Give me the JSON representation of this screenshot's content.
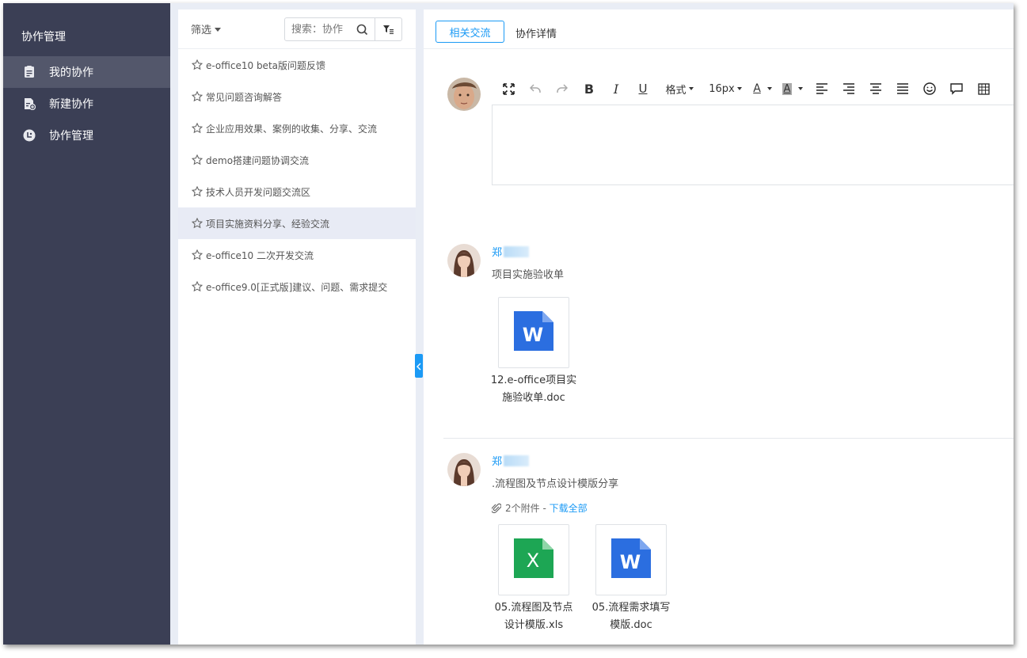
{
  "nav": {
    "title": "协作管理",
    "items": [
      {
        "label": "我的协作",
        "icon": "clipboard-icon",
        "active": true
      },
      {
        "label": "新建协作",
        "icon": "new-document-icon",
        "active": false
      },
      {
        "label": "协作管理",
        "icon": "manage-circle-icon",
        "active": false
      }
    ]
  },
  "list": {
    "filter_label": "筛选",
    "search_placeholder": "搜索：协作",
    "items": [
      "e-office10 beta版问题反馈",
      "常见问题咨询解答",
      "企业应用效果、案例的收集、分享、交流",
      "demo搭建问题协调交流",
      "技术人员开发问题交流区",
      "项目实施资料分享、经验交流",
      "e-office10 二次开发交流",
      "e-office9.0[正式版]建议、问题、需求提交"
    ],
    "selected_index": 5
  },
  "tabs": {
    "active": "相关交流",
    "other": "协作详情"
  },
  "toolbar": {
    "format_label": "格式",
    "size_label": "16px",
    "font_color_label": "A",
    "bg_color_label": "A",
    "bold": "B",
    "italic": "I",
    "underline": "U"
  },
  "posts": [
    {
      "author": "郑",
      "message": "项目实施验收单",
      "files": [
        {
          "name_line1": "12.e-office项目实",
          "name_line2": "施验收单.doc",
          "type": "word",
          "letter": "W"
        }
      ]
    },
    {
      "author": "郑",
      "message": ".流程图及节点设计模版分享",
      "attachments_count": "2个附件 -",
      "download_all": "下载全部",
      "files": [
        {
          "name_line1": "05.流程图及节点",
          "name_line2": "设计模版.xls",
          "type": "excel",
          "letter": "X"
        },
        {
          "name_line1": "05.流程需求填写",
          "name_line2": "模版.doc",
          "type": "word",
          "letter": "W"
        }
      ]
    }
  ],
  "colors": {
    "nav_bg": "#3b3f55",
    "accent": "#1b9af5",
    "word": "#2b6ee0",
    "excel": "#1da654"
  }
}
